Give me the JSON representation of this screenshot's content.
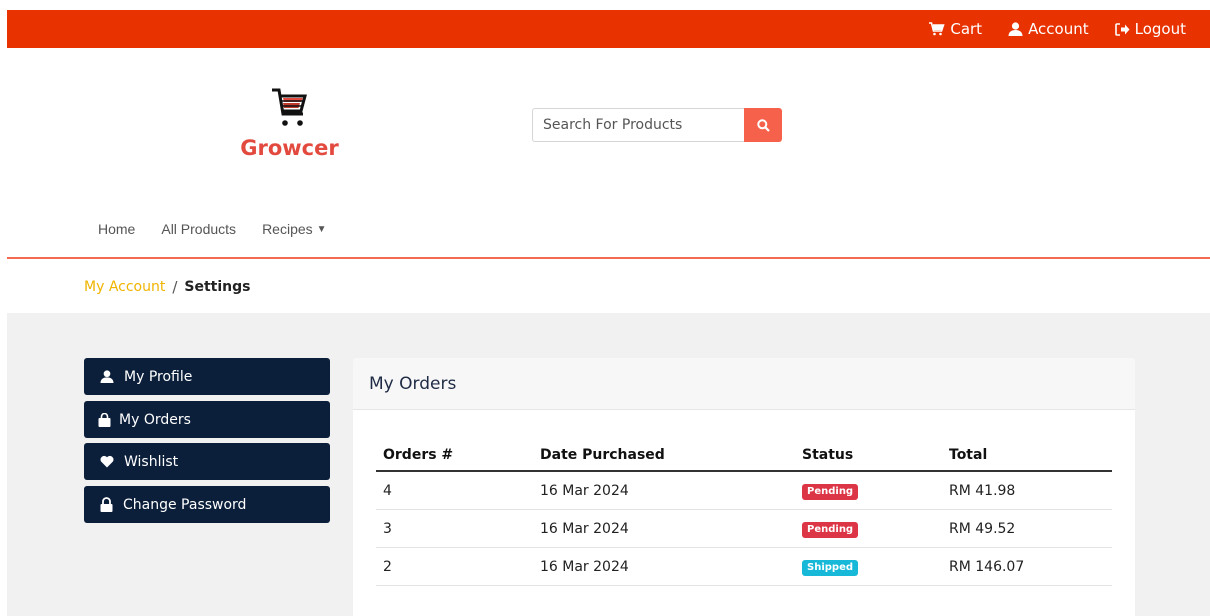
{
  "topbar": {
    "cart_label": "Cart",
    "account_label": "Account",
    "logout_label": "Logout",
    "background": "#e83200"
  },
  "logo": {
    "text": "Growcer",
    "color": "#e34a3f"
  },
  "search": {
    "placeholder": "Search For Products",
    "button_icon": "search-icon"
  },
  "nav": {
    "items": [
      {
        "label": "Home"
      },
      {
        "label": "All Products"
      },
      {
        "label": "Recipes"
      }
    ]
  },
  "breadcrumb": {
    "parent": "My Account",
    "separator": "/",
    "current": "Settings"
  },
  "sidebar": {
    "items": [
      {
        "label": "My Profile",
        "icon": "user-icon"
      },
      {
        "label": "My Orders",
        "icon": "shopping-bag-icon"
      },
      {
        "label": "Wishlist",
        "icon": "heart-icon"
      },
      {
        "label": "Change Password",
        "icon": "lock-icon"
      }
    ],
    "button_color": "#0b1e3a"
  },
  "orders": {
    "title": "My Orders",
    "columns": [
      "Orders #",
      "Date Purchased",
      "Status",
      "Total"
    ],
    "rows": [
      {
        "id": "4",
        "date": "16 Mar 2024",
        "status": "Pending",
        "status_color": "#dc3545",
        "total": "RM 41.98"
      },
      {
        "id": "3",
        "date": "16 Mar 2024",
        "status": "Pending",
        "status_color": "#dc3545",
        "total": "RM 49.52"
      },
      {
        "id": "2",
        "date": "16 Mar 2024",
        "status": "Shipped",
        "status_color": "#17b8d8",
        "total": "RM 146.07"
      }
    ]
  }
}
